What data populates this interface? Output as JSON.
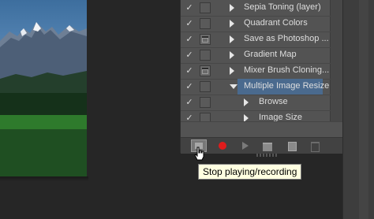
{
  "actions_panel": {
    "rows": [
      {
        "label": "Sepia Toning (layer)",
        "checked": true,
        "dialog": false,
        "expanded": false,
        "level": 1,
        "selected": false
      },
      {
        "label": "Quadrant Colors",
        "checked": true,
        "dialog": false,
        "expanded": false,
        "level": 1,
        "selected": false
      },
      {
        "label": "Save as Photoshop ...",
        "checked": true,
        "dialog": true,
        "expanded": false,
        "level": 1,
        "selected": false
      },
      {
        "label": "Gradient Map",
        "checked": true,
        "dialog": false,
        "expanded": false,
        "level": 1,
        "selected": false
      },
      {
        "label": "Mixer Brush Cloning...",
        "checked": true,
        "dialog": true,
        "expanded": false,
        "level": 1,
        "selected": false
      },
      {
        "label": "Multiple Image Resize",
        "checked": true,
        "dialog": false,
        "expanded": true,
        "level": 1,
        "selected": true
      },
      {
        "label": "Browse",
        "checked": true,
        "dialog": false,
        "expanded": false,
        "level": 2,
        "selected": false
      },
      {
        "label": "Image Size",
        "checked": true,
        "dialog": false,
        "expanded": false,
        "level": 2,
        "selected": false
      }
    ],
    "toolbar": {
      "buttons": [
        "stop-icon",
        "record-icon",
        "play-icon",
        "folder-icon",
        "new-action-icon",
        "trash-icon"
      ]
    }
  },
  "tooltip": {
    "text": "Stop playing/recording"
  },
  "colors": {
    "record": "#e01c1c",
    "selection": "#4a6a8e",
    "tooltip_bg": "#ffffe1"
  }
}
